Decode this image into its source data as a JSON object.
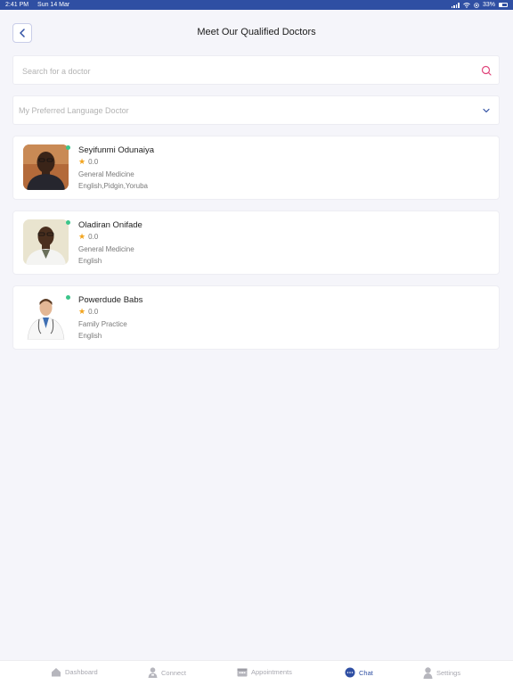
{
  "status_bar": {
    "time": "2:41 PM",
    "date": "Sun 14 Mar",
    "battery": "33%"
  },
  "header": {
    "title": "Meet Our Qualified Doctors",
    "back_icon": "chevron-left-icon"
  },
  "search": {
    "placeholder": "Search for a doctor",
    "value": "",
    "icon": "search-icon"
  },
  "language_filter": {
    "placeholder": "My Preferred Language Doctor",
    "icon": "chevron-down-icon"
  },
  "doctors": [
    {
      "name": "Seyifunmi Odunaiya",
      "rating": "0.0",
      "specialty": "General Medicine",
      "languages": "English,Pidgin,Yoruba",
      "online": true
    },
    {
      "name": "Oladiran Onifade",
      "rating": "0.0",
      "specialty": "General Medicine",
      "languages": "English",
      "online": true
    },
    {
      "name": "Powerdude Babs",
      "rating": "0.0",
      "specialty": "Family Practice",
      "languages": "English",
      "online": true
    }
  ],
  "tab_bar": {
    "items": [
      {
        "label": "Dashboard",
        "icon": "home-icon"
      },
      {
        "label": "Connect",
        "icon": "doctor-icon"
      },
      {
        "label": "Appointments",
        "icon": "calendar-icon"
      },
      {
        "label": "Chat",
        "icon": "chat-icon",
        "active": true
      },
      {
        "label": "Settings",
        "icon": "user-icon"
      }
    ],
    "active_color": "#2f4fa3",
    "inactive_color": "#a8a8b0"
  },
  "colors": {
    "status_bar": "#2f4fa3",
    "online": "#3cc58a",
    "star": "#f2a31b",
    "search_icon": "#e0457b"
  }
}
